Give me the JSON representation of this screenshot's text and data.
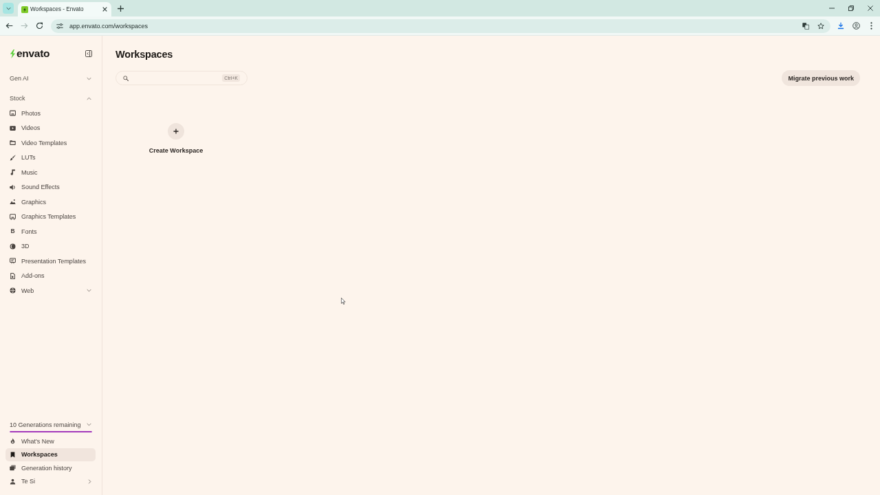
{
  "browser": {
    "tabs": [
      {
        "title": "Workspaces - Envato",
        "selected": true
      }
    ],
    "nav_buttons": [
      {
        "kind": "back",
        "disabled": false
      },
      {
        "kind": "forward",
        "disabled": true
      },
      {
        "kind": "reload",
        "disabled": false
      }
    ],
    "address": "app.envato.com/workspaces"
  },
  "sidebar": {
    "logo": "envato",
    "sections": [
      {
        "label": "Gen AI",
        "expanded": false
      },
      {
        "label": "Stock",
        "expanded": true,
        "items": [
          {
            "label": "Photos",
            "kind": "link"
          },
          {
            "label": "Videos",
            "kind": "link"
          },
          {
            "label": "Video Templates",
            "kind": "link"
          },
          {
            "label": "LUTs",
            "kind": "link"
          },
          {
            "label": "Music",
            "kind": "link"
          },
          {
            "label": "Sound Effects",
            "kind": "link"
          },
          {
            "label": "Graphics",
            "kind": "link"
          },
          {
            "label": "Graphics Templates",
            "kind": "link"
          },
          {
            "label": "Fonts",
            "kind": "link",
            "glyph": "B"
          },
          {
            "label": "3D",
            "kind": "link"
          },
          {
            "label": "Presentation Templates",
            "kind": "link"
          },
          {
            "label": "Add-ons",
            "kind": "link"
          },
          {
            "label": "Web",
            "kind": "group",
            "expanded": false
          }
        ]
      }
    ],
    "generations": {
      "label": "10 Generations remaining",
      "expanded": false,
      "level": 1
    },
    "bottom_items": [
      {
        "label": "What's New",
        "kind": "link",
        "selected": false
      },
      {
        "label": "Workspaces",
        "kind": "link",
        "selected": true
      },
      {
        "label": "Generation history",
        "kind": "link",
        "selected": false
      },
      {
        "label": "Te Si",
        "kind": "account",
        "selected": false
      }
    ]
  },
  "main": {
    "title": "Workspaces",
    "search": {
      "shortcut": "Ctrl+K"
    },
    "migrate_button": "Migrate previous work",
    "create_card": {
      "label": "Create Workspace"
    }
  }
}
